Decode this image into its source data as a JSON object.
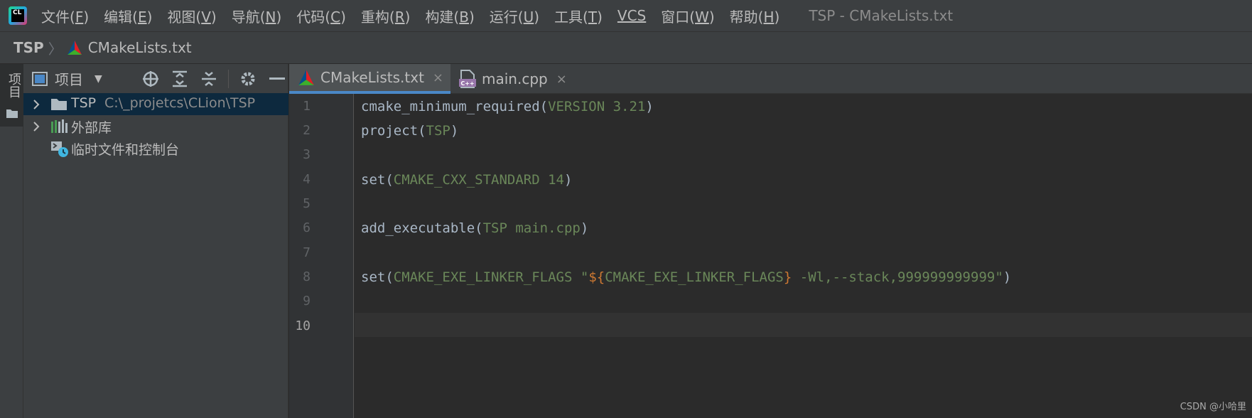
{
  "menu": {
    "items": [
      {
        "label": "文件(",
        "key": "F",
        "close": ")"
      },
      {
        "label": "编辑(",
        "key": "E",
        "close": ")"
      },
      {
        "label": "视图(",
        "key": "V",
        "close": ")"
      },
      {
        "label": "导航(",
        "key": "N",
        "close": ")"
      },
      {
        "label": "代码(",
        "key": "C",
        "close": ")"
      },
      {
        "label": "重构(",
        "key": "R",
        "close": ")"
      },
      {
        "label": "构建(",
        "key": "B",
        "close": ")"
      },
      {
        "label": "运行(",
        "key": "U",
        "close": ")"
      },
      {
        "label": "工具(",
        "key": "T",
        "close": ")"
      },
      {
        "label": "",
        "key": "VCS",
        "close": ""
      },
      {
        "label": "窗口(",
        "key": "W",
        "close": ")"
      },
      {
        "label": "帮助(",
        "key": "H",
        "close": ")"
      }
    ],
    "logo_text": "CL",
    "window_title": "TSP - CMakeLists.txt"
  },
  "breadcrumb": {
    "root": "TSP",
    "file": "CMakeLists.txt"
  },
  "sidebar_strip": {
    "project_label": "项目"
  },
  "project_panel": {
    "title": "项目",
    "tree": [
      {
        "label": "TSP",
        "path": "C:\\_projetcs\\CLion\\TSP",
        "icon": "folder-icon"
      },
      {
        "label": "外部库",
        "path": "",
        "icon": "library-icon"
      },
      {
        "label": "临时文件和控制台",
        "path": "",
        "icon": "scratch-icon"
      }
    ]
  },
  "editor": {
    "tabs": [
      {
        "label": "CMakeLists.txt",
        "icon": "cmake-icon",
        "active": true
      },
      {
        "label": "main.cpp",
        "icon": "cpp-file-icon",
        "active": false
      }
    ],
    "close_glyph": "×",
    "line_numbers": [
      "1",
      "2",
      "3",
      "4",
      "5",
      "6",
      "7",
      "8",
      "9",
      "10"
    ],
    "current_line": "10",
    "code": {
      "l1_fn": "cmake_minimum_required(",
      "l1_arg": "VERSION 3.21",
      "l1_end": ")",
      "l2_fn": "project(",
      "l2_arg": "TSP",
      "l2_end": ")",
      "l4_fn": "set(",
      "l4_arg": "CMAKE_CXX_STANDARD 14",
      "l4_end": ")",
      "l6_fn": "add_executable(",
      "l6_arg": "TSP main.cpp",
      "l6_end": ")",
      "l8_fn": "set(",
      "l8_arg": "CMAKE_EXE_LINKER_FLAGS ",
      "l8_q1": "\"",
      "l8_dol": "${",
      "l8_var": "CMAKE_EXE_LINKER_FLAGS",
      "l8_rb": "}",
      "l8_str": " -Wl,--stack,999999999999",
      "l8_q2": "\"",
      "l8_end": ")"
    }
  },
  "watermark": "CSDN @小哈里",
  "colors": {
    "background": "#2b2b2b",
    "chrome": "#3c3f41",
    "accent": "#4a88c7",
    "selection": "#0d293e",
    "string": "#6a8759",
    "keyword": "#cc7832"
  }
}
